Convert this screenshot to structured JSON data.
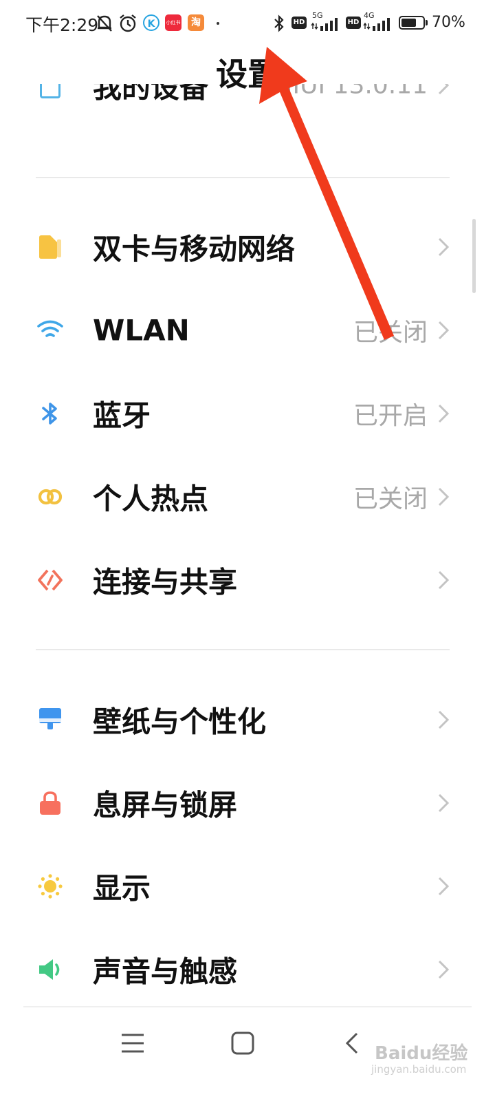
{
  "status_bar": {
    "time": "下午2:29",
    "battery_percent": "70%",
    "network_1": "5G",
    "network_2": "4G",
    "hd_label": "HD",
    "app_badge_1": "K",
    "app_badge_2": "小红书",
    "app_badge_3": "淘",
    "battery_level": 0.7
  },
  "header": {
    "title": "设置"
  },
  "top_item": {
    "label": "我的设备",
    "value": "MIUI 13.0.11"
  },
  "sections": [
    [
      {
        "key": "sim",
        "label": "双卡与移动网络",
        "value": "",
        "icon": "sim-card-icon",
        "color": "#f7c342"
      },
      {
        "key": "wlan",
        "label": "WLAN",
        "value": "已关闭",
        "icon": "wifi-icon",
        "color": "#3fa7e8"
      },
      {
        "key": "bluetooth",
        "label": "蓝牙",
        "value": "已开启",
        "icon": "bluetooth-icon",
        "color": "#3f95e8"
      },
      {
        "key": "hotspot",
        "label": "个人热点",
        "value": "已关闭",
        "icon": "hotspot-icon",
        "color": "#f2c140"
      },
      {
        "key": "connection",
        "label": "连接与共享",
        "value": "",
        "icon": "share-connection-icon",
        "color": "#f2735c"
      }
    ],
    [
      {
        "key": "wallpaper",
        "label": "壁纸与个性化",
        "value": "",
        "icon": "wallpaper-icon",
        "color": "#3f95ee"
      },
      {
        "key": "lockscreen",
        "label": "息屏与锁屏",
        "value": "",
        "icon": "lock-icon",
        "color": "#f7705e"
      },
      {
        "key": "display",
        "label": "显示",
        "value": "",
        "icon": "sun-icon",
        "color": "#f7c93f"
      },
      {
        "key": "sound",
        "label": "声音与触感",
        "value": "",
        "icon": "speaker-icon",
        "color": "#43c984"
      }
    ]
  ],
  "watermark": {
    "brand": "Baidu经验",
    "url": "jingyan.baidu.com"
  },
  "annotation": {
    "arrow_color": "#f03a1c"
  }
}
